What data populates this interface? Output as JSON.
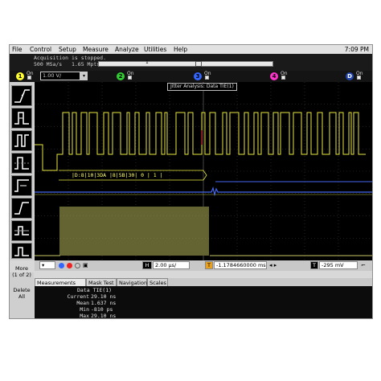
{
  "menu": {
    "items": [
      "File",
      "Control",
      "Setup",
      "Measure",
      "Analyze",
      "Utilities",
      "Help"
    ],
    "clock": "7:09 PM"
  },
  "acquisition": {
    "status": "Acquisition is stopped.",
    "rate": "500 MSa/s   1.65 Mpts"
  },
  "trigger_marker": "1",
  "channels": [
    {
      "num": "1",
      "state": "On",
      "color": "#ffff33"
    },
    {
      "num": "2",
      "state": "On",
      "color": "#33cc33"
    },
    {
      "num": "3",
      "state": "On",
      "color": "#3366ff"
    },
    {
      "num": "4",
      "state": "On",
      "color": "#ff33cc"
    }
  ],
  "ch1_scale": "1.00 V/",
  "math_label": "D",
  "math_state": "On",
  "screen_title": "Jitter Analysis: Data TIE(1)",
  "decode_text": "|D:8|10|3DA |8|5B|30| 0 | 1 |",
  "side_buttons": {
    "more": "More",
    "more_sub": "(1 of 2)",
    "delete": "Delete",
    "delete_sub": "All"
  },
  "timebase": {
    "hbox_label": "H",
    "scale": "2.00 µs/",
    "delay_label": "T",
    "delay": "-1.1784660000 ms",
    "trig_label": "T",
    "trig_level": "-295 mV"
  },
  "tabs": [
    "Measurements",
    "Mask Test",
    "Navigation",
    "Scales"
  ],
  "measurements": {
    "header": "Data TIE(1)",
    "rows": [
      {
        "label": "Current",
        "value": "29.10 ns"
      },
      {
        "label": "Mean",
        "value": "1.637 ns"
      },
      {
        "label": "Min",
        "value": "-810 ps"
      },
      {
        "label": "Max",
        "value": "29.10 ns"
      }
    ]
  },
  "colors": {
    "trace_yellow": "#e8e840",
    "trace_blue": "#4466ee",
    "trace_olive": "#c8c864",
    "grid": "#3a3a3a"
  }
}
